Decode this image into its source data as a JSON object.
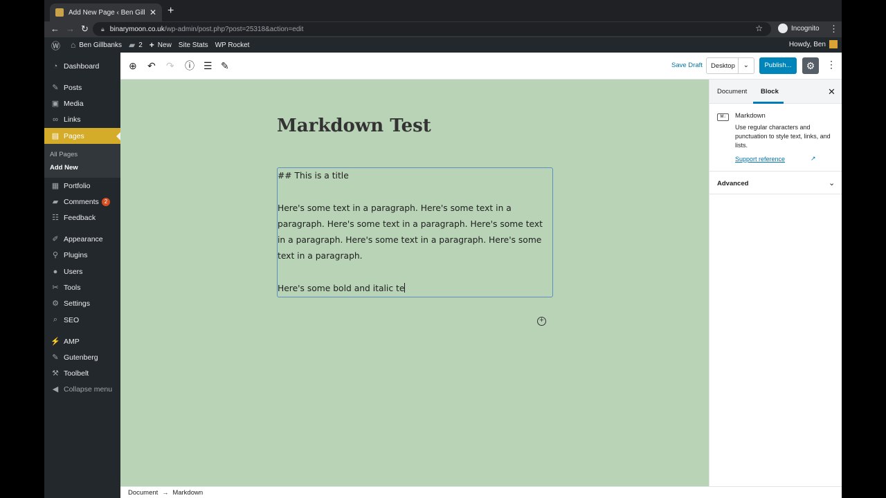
{
  "browser": {
    "tab_title": "Add New Page ‹ Ben Gillbanks —",
    "tab_close": "✕",
    "new_tab": "+",
    "url_host": "binarymoon.co.uk",
    "url_path": "/wp-admin/post.php?post=25318&action=edit",
    "incognito_label": "Incognito"
  },
  "admin_bar": {
    "site_name": "Ben Gillbanks",
    "comments_count": "2",
    "new_label": "New",
    "site_stats": "Site Stats",
    "wp_rocket": "WP Rocket",
    "howdy": "Howdy, Ben"
  },
  "sidebar": {
    "items": [
      {
        "label": "Dashboard"
      },
      {
        "label": "Posts"
      },
      {
        "label": "Media"
      },
      {
        "label": "Links"
      },
      {
        "label": "Pages"
      },
      {
        "label": "Portfolio"
      },
      {
        "label": "Comments"
      },
      {
        "label": "Feedback"
      },
      {
        "label": "Appearance"
      },
      {
        "label": "Plugins"
      },
      {
        "label": "Users"
      },
      {
        "label": "Tools"
      },
      {
        "label": "Settings"
      },
      {
        "label": "SEO"
      },
      {
        "label": "AMP"
      },
      {
        "label": "Gutenberg"
      },
      {
        "label": "Toolbelt"
      },
      {
        "label": "Collapse menu"
      }
    ],
    "pages_submenu": [
      "All Pages",
      "Add New"
    ],
    "comments_badge": "2"
  },
  "editor_header": {
    "save_draft": "Save Draft",
    "device": "Desktop",
    "publish": "Publish..."
  },
  "post": {
    "title": "Markdown Test",
    "markdown_text": "## This is a title\n\nHere's some text in a paragraph. Here's some text in a paragraph. Here's some text in a paragraph. Here's some text in a paragraph. Here's some text in a paragraph. Here's some text in a paragraph.\n\nHere's some bold and italic te"
  },
  "inspector": {
    "tabs": [
      "Document",
      "Block"
    ],
    "block_name": "Markdown",
    "block_description": "Use regular characters and punctuation to style text, links, and lists.",
    "support_link": "Support reference",
    "advanced": "Advanced"
  },
  "breadcrumb": [
    "Document",
    "Markdown"
  ],
  "colors": {
    "accent": "#0085ba",
    "canvas": "#b8d3b6",
    "admin_menu": "#23282d",
    "active_menu": "#d5ac2a"
  }
}
